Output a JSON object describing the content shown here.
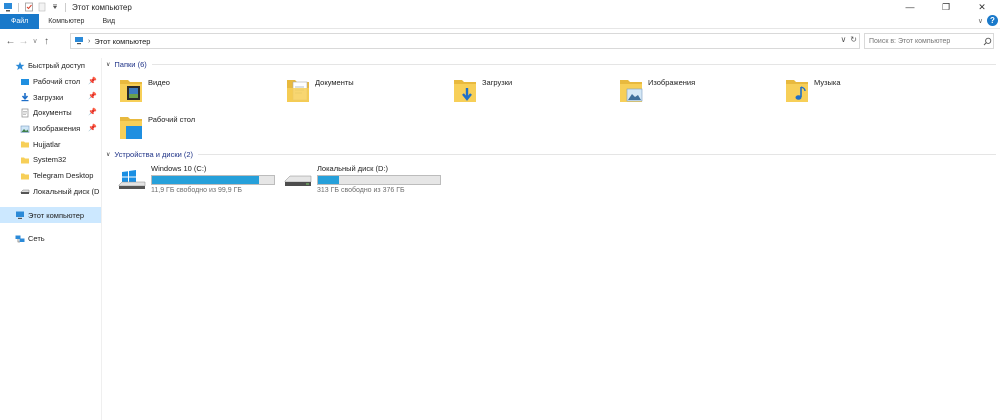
{
  "window": {
    "title": "Этот компьютер"
  },
  "ribbon": {
    "tabs": [
      "Файл",
      "Компьютер",
      "Вид"
    ]
  },
  "address": {
    "path": "Этот компьютер",
    "search_placeholder": "Поиск в: Этот компьютер"
  },
  "nav": {
    "quick_access": "Быстрый доступ",
    "pinned": [
      "Рабочий стол",
      "Загрузки",
      "Документы",
      "Изображения"
    ],
    "others": [
      "Hujjatlar",
      "System32",
      "Telegram Desktop",
      "Локальный диск (D"
    ],
    "this_pc": "Этот компьютер",
    "network": "Сеть"
  },
  "folders_group": "Папки (6)",
  "folders": [
    {
      "name": "Видео",
      "icon": "video-folder-icon"
    },
    {
      "name": "Документы",
      "icon": "documents-folder-icon"
    },
    {
      "name": "Загрузки",
      "icon": "downloads-folder-icon"
    },
    {
      "name": "Изображения",
      "icon": "pictures-folder-icon"
    },
    {
      "name": "Музыка",
      "icon": "music-folder-icon"
    },
    {
      "name": "Рабочий стол",
      "icon": "desktop-folder-icon"
    }
  ],
  "drives_group": "Устройства и диски (2)",
  "drives": [
    {
      "name": "Windows 10 (C:)",
      "free_text": "11,9 ГБ свободно из 99,9 ГБ",
      "used_fraction": 0.88,
      "icon": "windows-drive-icon"
    },
    {
      "name": "Локальный диск (D:)",
      "free_text": "313 ГБ свободно из 376 ГБ",
      "used_fraction": 0.17,
      "icon": "local-drive-icon"
    }
  ],
  "colors": {
    "accent": "#1979ca",
    "bar_fill": "#26a0da",
    "group_header": "#1e3287",
    "selection": "#cce8ff",
    "folder": "#f7cf58"
  }
}
